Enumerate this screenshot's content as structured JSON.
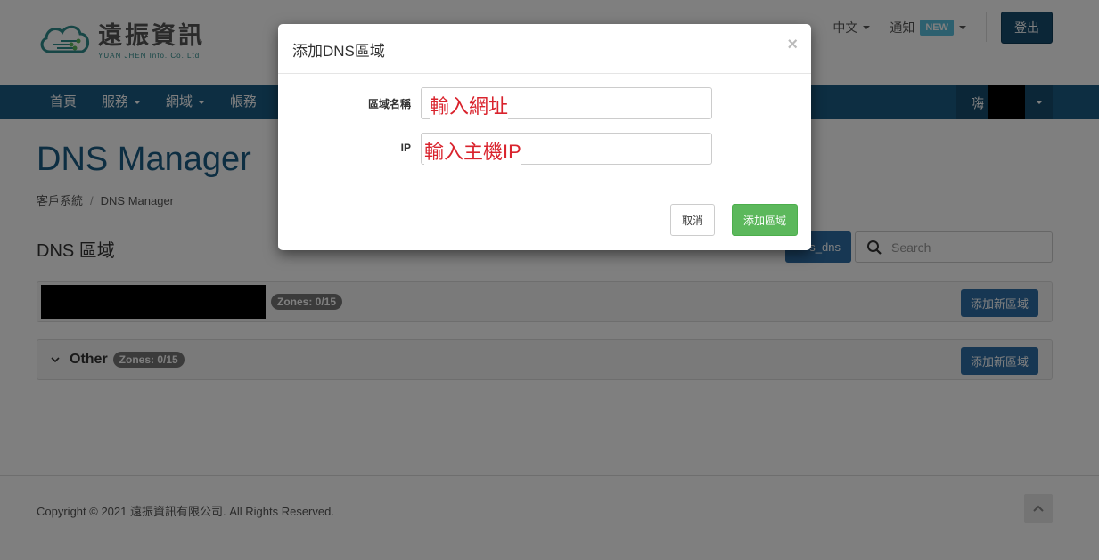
{
  "header": {
    "logo_name": "遠振資訊",
    "logo_sub": "YUAN JHEN Info. Co. Ltd",
    "language": "中文",
    "notifications": "通知",
    "new_badge": "NEW",
    "logout": "登出"
  },
  "nav": {
    "items": [
      "首頁",
      "服務",
      "網域",
      "帳務"
    ],
    "user_greeting": "嗨"
  },
  "page": {
    "title": "DNS Manager",
    "breadcrumb": [
      "客戶系統",
      "DNS Manager"
    ],
    "section_title": "DNS 區域",
    "filter_button": "s_dns",
    "search_placeholder": "Search"
  },
  "zone_groups": [
    {
      "name": "",
      "zones": "Zones: 0/15",
      "add_button": "添加新區域"
    },
    {
      "name": "Other",
      "zones": "Zones: 0/15",
      "add_button": "添加新區域"
    }
  ],
  "footer": {
    "copyright": "Copyright © 2021 遠振資訊有限公司. All Rights Reserved."
  },
  "modal": {
    "title": "添加DNS區域",
    "close": "×",
    "zone_name_label": "區域名稱",
    "zone_name_note": "輸入網址",
    "ip_label": "IP",
    "ip_note": "輸入主機IP",
    "cancel": "取消",
    "submit": "添加區域"
  },
  "colors": {
    "brand": "#1b5c85",
    "primary_button": "#2f6fa7",
    "success_button": "#5cb85c",
    "annotation": "#d9232d"
  }
}
